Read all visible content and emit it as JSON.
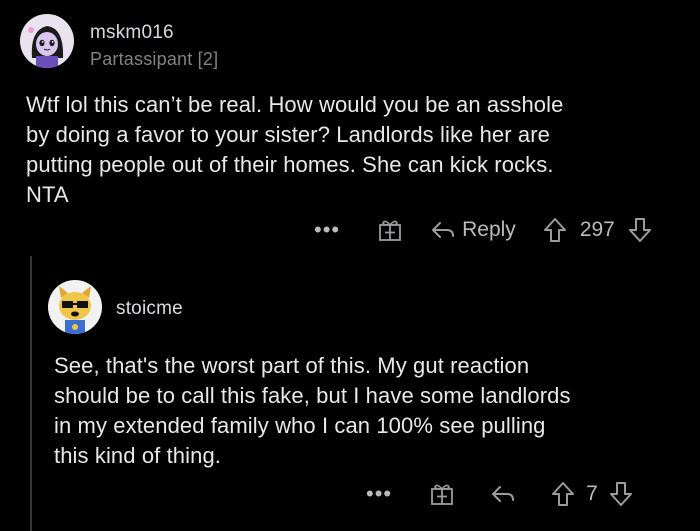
{
  "comments": [
    {
      "username": "mskm016",
      "flair": "Partassipant [2]",
      "body": [
        "Wtf lol this can’t be real. How would you be an asshole",
        "by doing a favor to your sister? Landlords like her are",
        "putting people out of their homes. She can kick rocks.",
        "NTA"
      ],
      "actions": {
        "more": "•••",
        "reply": "Reply",
        "score": "297"
      }
    },
    {
      "username": "stoicme",
      "body": [
        "See, that's the worst part of this. My gut reaction",
        "should be to call this fake, but I have some landlords",
        "in my extended family who I can 100% see pulling",
        "this kind of thing."
      ],
      "actions": {
        "more": "•••",
        "score": "7"
      }
    }
  ],
  "icons": {
    "award": "gift-award-icon",
    "reply": "reply-arrow-icon",
    "upvote": "upvote-arrow-icon",
    "downvote": "downvote-arrow-icon"
  },
  "colors": {
    "background": "#000000",
    "text": "#e8e8e8",
    "muted": "#818384",
    "avatar1_bg": "#e9e2ef",
    "avatar2_bg": "#f2f2f2"
  }
}
